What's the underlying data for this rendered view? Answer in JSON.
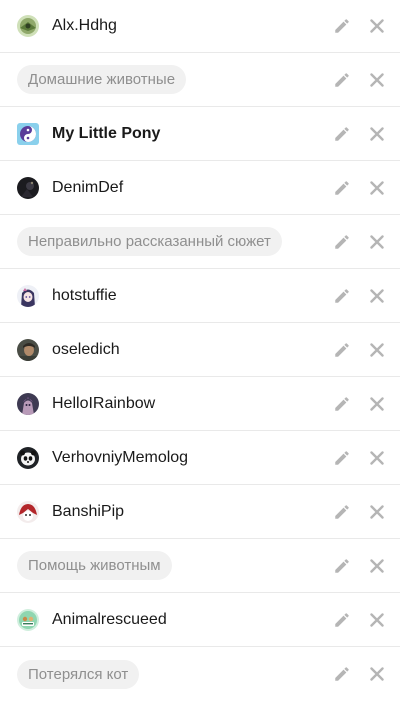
{
  "items": [
    {
      "type": "user",
      "label": "Alx.Hdhg",
      "avatar": "green-figure-avatar",
      "bold": false
    },
    {
      "type": "tag",
      "label": "Домашние животные"
    },
    {
      "type": "user",
      "label": "My Little Pony",
      "avatar": "pony-yinyang-avatar",
      "bold": true
    },
    {
      "type": "user",
      "label": "DenimDef",
      "avatar": "dark-photo-avatar",
      "bold": false
    },
    {
      "type": "tag",
      "label": "Неправильно рассказанный сюжет"
    },
    {
      "type": "user",
      "label": "hotstuffie",
      "avatar": "anime-girl-avatar",
      "bold": false
    },
    {
      "type": "user",
      "label": "oseledich",
      "avatar": "face-photo-avatar",
      "bold": false
    },
    {
      "type": "user",
      "label": "HelloIRainbow",
      "avatar": "pony-portrait-avatar",
      "bold": false
    },
    {
      "type": "user",
      "label": "VerhovniyMemolog",
      "avatar": "panda-avatar",
      "bold": false
    },
    {
      "type": "user",
      "label": "BanshiPip",
      "avatar": "red-white-character-avatar",
      "bold": false
    },
    {
      "type": "tag",
      "label": "Помощь животным"
    },
    {
      "type": "user",
      "label": "Animalrescueed",
      "avatar": "animal-rescue-logo-avatar",
      "bold": false
    },
    {
      "type": "tag",
      "label": "Потерялся кот"
    }
  ],
  "icons": {
    "edit": "pencil-icon",
    "delete": "close-icon"
  },
  "colors": {
    "text": "#1a1a1a",
    "tag_bg": "#f1f1f1",
    "tag_text": "#8f8f8f",
    "icon": "#b5b5b5",
    "divider": "#e9e9e9"
  }
}
